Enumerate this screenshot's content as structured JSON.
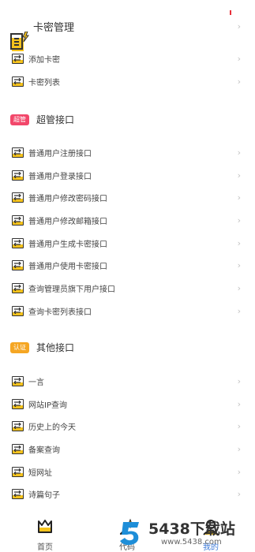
{
  "header": {
    "title": "卡密管理",
    "chevron": "›"
  },
  "card_items": [
    {
      "label": "添加卡密",
      "chevron": "›"
    },
    {
      "label": "卡密列表",
      "chevron": "›"
    }
  ],
  "admin_section": {
    "badge": "超管",
    "badge_color": "#f2476a",
    "title": "超管接口"
  },
  "admin_items": [
    {
      "label": "普通用户注册接口",
      "chevron": "›"
    },
    {
      "label": "普通用户登录接口",
      "chevron": "›"
    },
    {
      "label": "普通用户修改密码接口",
      "chevron": "›"
    },
    {
      "label": "普通用户修改邮箱接口",
      "chevron": "›"
    },
    {
      "label": "普通用户生成卡密接口",
      "chevron": "›"
    },
    {
      "label": "普通用户使用卡密接口",
      "chevron": "›"
    },
    {
      "label": "查询管理员旗下用户接口",
      "chevron": "›"
    },
    {
      "label": "查询卡密列表接口",
      "chevron": "›"
    }
  ],
  "other_section": {
    "badge": "认证",
    "badge_color": "#f5a623",
    "title": "其他接口"
  },
  "other_items": [
    {
      "label": "一言",
      "chevron": "›"
    },
    {
      "label": "网站IP查询",
      "chevron": "›"
    },
    {
      "label": "历史上的今天",
      "chevron": "›"
    },
    {
      "label": "备案查询",
      "chevron": "›"
    },
    {
      "label": "短网址",
      "chevron": "›"
    },
    {
      "label": "诗篇句子",
      "chevron": "›"
    }
  ],
  "tabbar": {
    "tabs": [
      {
        "label": "首页",
        "icon": "crown-icon"
      },
      {
        "label": "代码",
        "icon": "magic-wand-icon"
      },
      {
        "label": "我的",
        "icon": "user-icon"
      }
    ]
  },
  "watermark": {
    "text": "5438下载站",
    "url": "www.5438.com"
  },
  "colors": {
    "accent": "#f6c31d",
    "tab_active": "#3a78d8"
  }
}
